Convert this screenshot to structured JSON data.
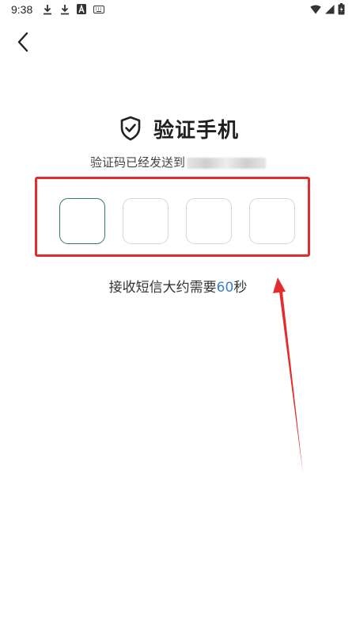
{
  "status_bar": {
    "time": "9:38",
    "left_icons": [
      "download-icon",
      "download-icon",
      "app-icon",
      "keyboard-icon"
    ],
    "right_icons": [
      "wifi-icon",
      "signal-icon",
      "battery-icon"
    ]
  },
  "header": {
    "back_icon": "chevron-left-icon"
  },
  "verify": {
    "shield_icon": "shield-check-icon",
    "title": "验证手机",
    "subtitle_prefix": "验证码已经发送到",
    "code_boxes": [
      "",
      "",
      "",
      ""
    ],
    "hint_prefix": "接收短信大约需要",
    "countdown": "60",
    "hint_suffix": "秒"
  },
  "colors": {
    "accent": "#3a7fc4",
    "active_box_border": "#2f7a70",
    "annotation_red": "#e32c2c"
  }
}
